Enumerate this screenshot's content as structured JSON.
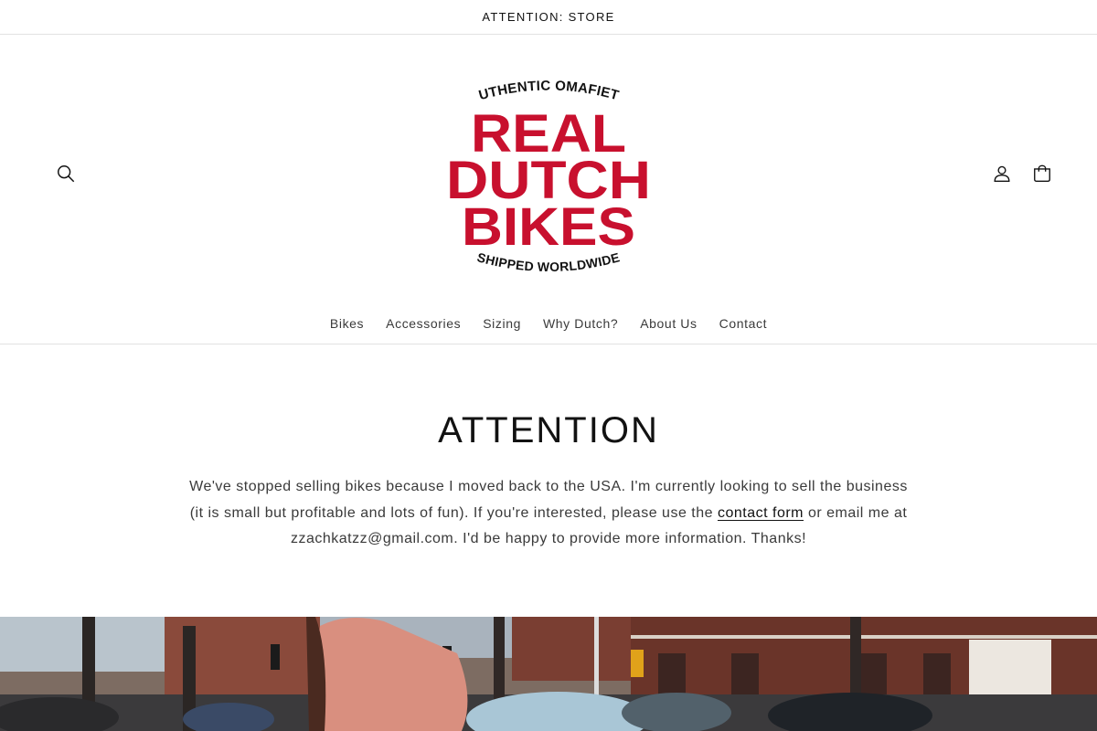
{
  "announcement": {
    "text": "ATTENTION: STORE"
  },
  "header": {
    "search_icon": "search-icon",
    "account_icon": "account-icon",
    "cart_icon": "cart-icon",
    "logo": {
      "top_line": "AUTHENTIC OMAFIETS",
      "line1": "REAL",
      "line2": "DUTCH",
      "line3": "BIKES",
      "bottom_line": "SHIPPED WORLDWIDE"
    }
  },
  "nav": {
    "items": [
      {
        "label": "Bikes"
      },
      {
        "label": "Accessories"
      },
      {
        "label": "Sizing"
      },
      {
        "label": "Why Dutch?"
      },
      {
        "label": "About Us"
      },
      {
        "label": "Contact"
      }
    ]
  },
  "main": {
    "title": "ATTENTION",
    "message_before": "We've stopped selling bikes because I moved back to the USA. I'm currently looking to sell the business (it is small but profitable and lots of fun). If you're interested, please use the ",
    "contact_link": "contact form",
    "message_after": " or email me at zzachkatzz@gmail.com. I'd be happy to provide more information. Thanks!"
  },
  "colors": {
    "brand_red": "#c8102e",
    "text": "#121212",
    "muted": "#3a3a3a",
    "border": "#e2e2e2"
  }
}
